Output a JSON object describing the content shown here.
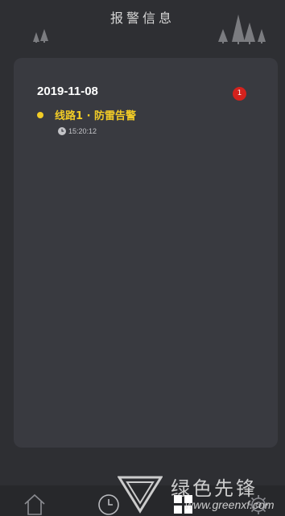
{
  "header": {
    "title": "报警信息"
  },
  "alarm_group": {
    "date": "2019-11-08",
    "badge_count": "1",
    "items": [
      {
        "title": "线路1 · 防雷告警",
        "time": "15:20:12",
        "status_color": "#f2cc26"
      }
    ]
  },
  "tabbar": {
    "tabs": [
      {
        "icon": "home-icon"
      },
      {
        "icon": "clock-icon"
      },
      {
        "icon": "grid-icon"
      },
      {
        "icon": "gear-icon"
      }
    ]
  },
  "watermark": {
    "text_cn": "绿色先锋",
    "text_en": "www.greenxf.com"
  },
  "colors": {
    "background": "#2e2f33",
    "card": "#393a40",
    "accent": "#f2cc26",
    "badge": "#d3221d"
  }
}
